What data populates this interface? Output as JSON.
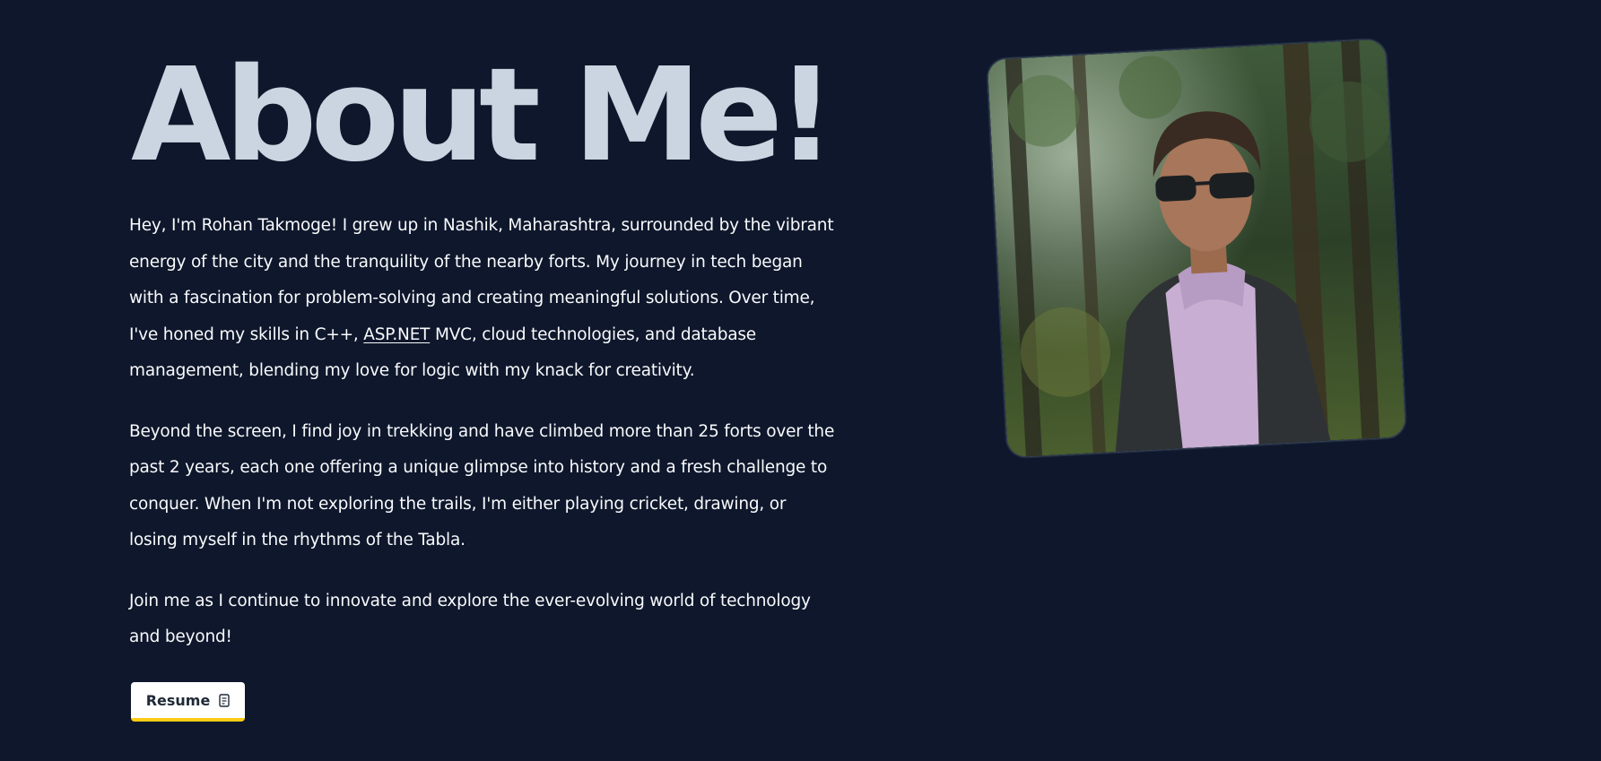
{
  "about": {
    "title": "About Me!",
    "paragraphs": {
      "p1_before_link": "Hey, I'm Rohan Takmoge! I grew up in Nashik, Maharashtra, surrounded by the vibrant energy of the city and the tranquility of the nearby forts. My journey in tech began with a fascination for problem-solving and creating meaningful solutions. Over time, I've honed my skills in C++, ",
      "p1_link": "ASP.NET",
      "p1_after_link": " MVC, cloud technologies, and database management, blending my love for logic with my knack for creativity.",
      "p2": "Beyond the screen, I find joy in trekking and have climbed more than 25 forts over the past 2 years, each one offering a unique glimpse into history and a fresh challenge to conquer. When I'm not exploring the trails, I'm either playing cricket, drawing, or losing myself in the rhythms of the Tabla.",
      "p3": "Join me as I continue to innovate and explore the ever-evolving world of technology and beyond!"
    },
    "resume_button": {
      "label": "Resume",
      "icon": "document-icon",
      "accent": "#facc15"
    },
    "photo": {
      "alt": "Rohan Takmoge",
      "icon": "profile-photo"
    }
  },
  "colors": {
    "background": "#0e172b",
    "title": "#cbd5e1",
    "text": "#f8fafc"
  }
}
